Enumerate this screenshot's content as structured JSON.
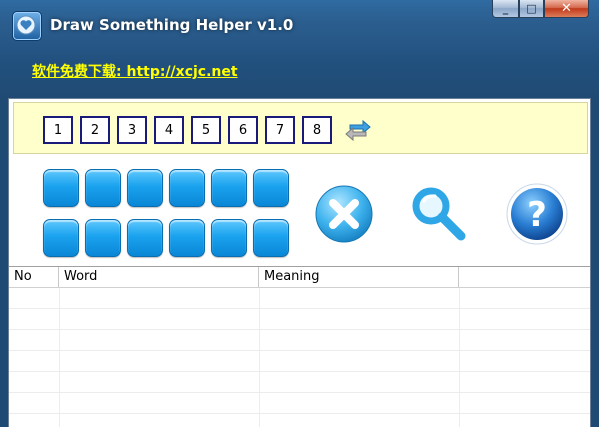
{
  "window": {
    "title": "Draw Something Helper v1.0",
    "minimize_label": "_",
    "maximize_label": "□",
    "close_label": "✕"
  },
  "link": {
    "text": "软件免费下载: http://xcjc.net"
  },
  "letter_slots": [
    "1",
    "2",
    "3",
    "4",
    "5",
    "6",
    "7",
    "8"
  ],
  "letter_tiles": {
    "rows": 2,
    "columns": 6,
    "color": "#1aa2ee"
  },
  "actions": {
    "clear_icon": "clear-x-icon",
    "search_icon": "magnifier-icon",
    "help_icon": "help-question-icon"
  },
  "table": {
    "columns": [
      "No",
      "Word",
      "Meaning"
    ],
    "rows": []
  },
  "colors": {
    "titlebar": "#2b5e8f",
    "link": "#ffff00",
    "letter_bar_bg": "#ffffcc",
    "tile": "#1aa2ee"
  }
}
